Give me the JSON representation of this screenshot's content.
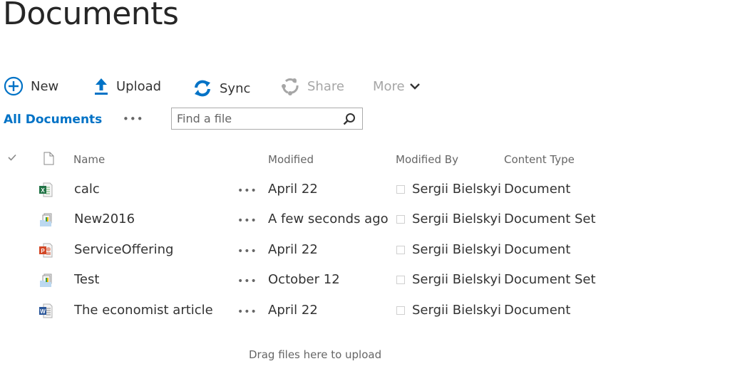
{
  "page": {
    "title": "Documents"
  },
  "commands": [
    {
      "label": "New",
      "icon": "plus-circle-icon",
      "enabled": true
    },
    {
      "label": "Upload",
      "icon": "upload-arrow-icon",
      "enabled": true
    },
    {
      "label": "Sync",
      "icon": "sync-icon",
      "enabled": true
    },
    {
      "label": "Share",
      "icon": "share-icon",
      "enabled": false
    },
    {
      "label": "More",
      "icon": "chevron-down-icon",
      "enabled": false
    }
  ],
  "view": {
    "current": "All Documents",
    "more": "•••"
  },
  "search": {
    "placeholder": "Find a file",
    "value": ""
  },
  "table": {
    "columns": {
      "select": "✓",
      "type": "file-icon",
      "name": "Name",
      "modified": "Modified",
      "modified_by": "Modified By",
      "content_type": "Content Type"
    },
    "rows": [
      {
        "icon": "excel-file-icon",
        "name": "calc",
        "actions": "•••",
        "modified": "April 22",
        "modified_by": "Sergii Bielskyi",
        "content_type": "Document"
      },
      {
        "icon": "document-set-icon",
        "name": "New2016",
        "actions": "•••",
        "modified": "A few seconds ago",
        "modified_by": "Sergii Bielskyi",
        "content_type": "Document Set"
      },
      {
        "icon": "powerpoint-file-icon",
        "name": "ServiceOffering",
        "actions": "•••",
        "modified": "April 22",
        "modified_by": "Sergii Bielskyi",
        "content_type": "Document"
      },
      {
        "icon": "document-set-icon",
        "name": "Test",
        "actions": "•••",
        "modified": "October 12",
        "modified_by": "Sergii Bielskyi",
        "content_type": "Document Set"
      },
      {
        "icon": "word-file-icon",
        "name": "The economist article",
        "actions": "•••",
        "modified": "April 22",
        "modified_by": "Sergii Bielskyi",
        "content_type": "Document"
      }
    ]
  },
  "dropzone": {
    "text": "Drag files here to upload"
  },
  "colors": {
    "accent": "#0072c6",
    "excel": "#217346",
    "powerpoint": "#d24726",
    "word": "#2b579a",
    "disabled": "#a6a6a6"
  }
}
